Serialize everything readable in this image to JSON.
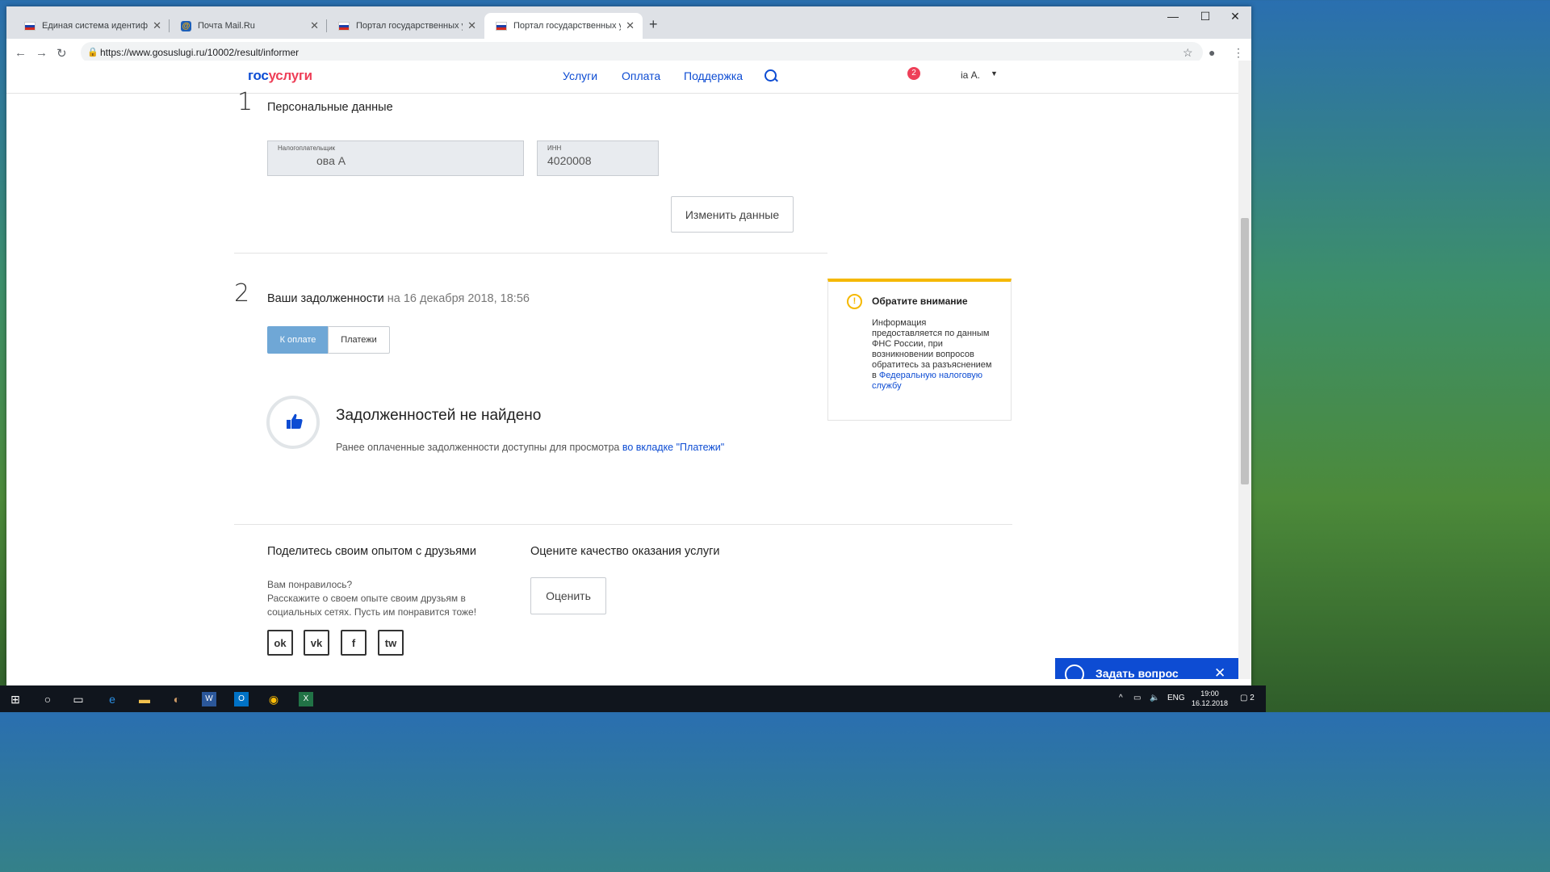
{
  "browser": {
    "tabs": [
      {
        "title": "Единая система идентификации",
        "icon": "russia-flag"
      },
      {
        "title": "Почта Mail.Ru",
        "icon": "mail-ru"
      },
      {
        "title": "Портал государственных услуг",
        "icon": "russia-flag"
      },
      {
        "title": "Портал государственных услуг",
        "icon": "russia-flag",
        "active": true
      }
    ],
    "url": "https://www.gosuslugi.ru/10002/result/informer"
  },
  "header": {
    "logo_part1": "гос",
    "logo_part2": "услуги",
    "menu": [
      "Услуги",
      "Оплата",
      "Поддержка"
    ],
    "notifications_count": "2",
    "user_name": "іа А."
  },
  "step1": {
    "number": "1",
    "title": "Персональные данные",
    "taxpayer_label": "Налогоплательщик",
    "taxpayer_value": "ова А",
    "inn_label": "ИНН",
    "inn_value": "4020008",
    "change_button": "Изменить данные"
  },
  "step2": {
    "number": "2",
    "title": "Ваши задолженности",
    "date_text": "на 16 декабря 2018, 18:56",
    "tab_pay": "К оплате",
    "tab_payments": "Платежи",
    "no_debts": "Задолженностей не найдено",
    "hint": "Ранее оплаченные задолженности доступны для просмотра",
    "hint_link": "во вкладке \"Платежи\""
  },
  "notice": {
    "title": "Обратите внимание",
    "body": "Информация предоставляется по данным ФНС России, при возникновении вопросов обратитесь за разъяснением в",
    "link": "Федеральную налоговую службу"
  },
  "share": {
    "title": "Поделитесь своим опытом с друзьями",
    "line1": "Вам понравилось?",
    "line2": "Расскажите о своем опыте своим друзьям в социальных сетях. Пусть им понравится тоже!",
    "networks": [
      "ok",
      "vk",
      "f",
      "tw"
    ]
  },
  "rate": {
    "title": "Оцените качество оказания услуги",
    "button": "Оценить"
  },
  "chat": {
    "label": "Задать вопрос"
  },
  "taskbar": {
    "lang": "ENG",
    "time": "19:00",
    "date": "16.12.2018",
    "notifications": "2"
  },
  "colors": {
    "brand_blue": "#0d4cd3",
    "brand_red": "#ee3f58",
    "notice_yellow": "#f5b800",
    "tab_active": "#6fa7d6"
  }
}
